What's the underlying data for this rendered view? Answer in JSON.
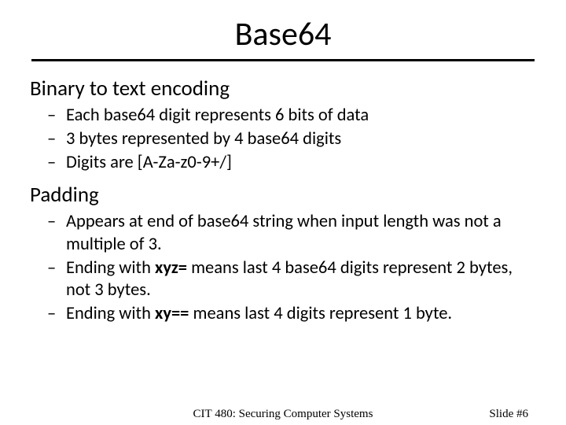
{
  "title": "Base64",
  "sections": [
    {
      "heading": "Binary to text encoding",
      "bullets": [
        {
          "segments": [
            {
              "t": "Each base64 digit represents 6 bits of data",
              "b": false
            }
          ]
        },
        {
          "segments": [
            {
              "t": "3 bytes represented by 4 base64 digits",
              "b": false
            }
          ]
        },
        {
          "segments": [
            {
              "t": "Digits are [A-Za-z0-9+/]",
              "b": false
            }
          ]
        }
      ]
    },
    {
      "heading": "Padding",
      "bullets": [
        {
          "segments": [
            {
              "t": "Appears at end of base64 string when input length was not a multiple of 3.",
              "b": false
            }
          ]
        },
        {
          "segments": [
            {
              "t": "Ending with ",
              "b": false
            },
            {
              "t": "xyz=",
              "b": true
            },
            {
              "t": " means last 4 base64 digits represent 2 bytes, not 3 bytes.",
              "b": false
            }
          ]
        },
        {
          "segments": [
            {
              "t": "Ending with ",
              "b": false
            },
            {
              "t": "xy==",
              "b": true
            },
            {
              "t": " means last 4 digits represent 1 byte.",
              "b": false
            }
          ]
        }
      ]
    }
  ],
  "footer": {
    "center": "CIT 480: Securing Computer Systems",
    "right": "Slide #6"
  },
  "dash": "–"
}
